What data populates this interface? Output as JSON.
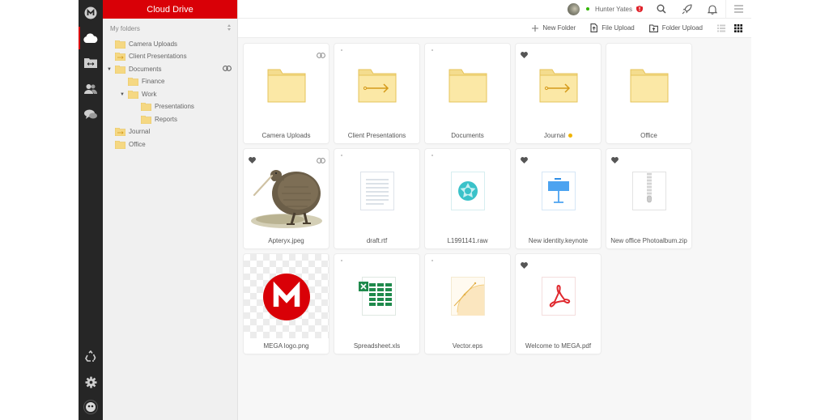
{
  "app": {
    "title": "Cloud Drive",
    "brand_color": "#d90007"
  },
  "rail": {
    "items": [
      {
        "icon": "mega-logo-icon"
      },
      {
        "icon": "cloud-drive-icon",
        "active": true
      },
      {
        "icon": "shared-folder-icon"
      },
      {
        "icon": "contacts-icon"
      },
      {
        "icon": "chat-icon"
      },
      {
        "icon": "rubbish-bin-icon"
      },
      {
        "icon": "settings-icon"
      },
      {
        "icon": "account-avatar-icon"
      }
    ]
  },
  "tree": {
    "header": "My folders",
    "sort_icon": "sort-icon",
    "items": [
      {
        "label": "Camera Uploads",
        "level": 0,
        "icon": "folder-icon"
      },
      {
        "label": "Client Presentations",
        "level": 0,
        "icon": "incoming-folder-icon"
      },
      {
        "label": "Documents",
        "level": 0,
        "expanded": true,
        "icon": "folder-icon",
        "linked": true
      },
      {
        "label": "Finance",
        "level": 1,
        "icon": "folder-icon"
      },
      {
        "label": "Work",
        "level": 1,
        "expanded": true,
        "icon": "folder-icon"
      },
      {
        "label": "Presentations",
        "level": 2,
        "icon": "folder-icon"
      },
      {
        "label": "Reports",
        "level": 2,
        "icon": "folder-icon"
      },
      {
        "label": "Journal",
        "level": 0,
        "icon": "incoming-folder-icon"
      },
      {
        "label": "Office",
        "level": 0,
        "icon": "folder-icon"
      }
    ]
  },
  "topbar": {
    "user_name": "Hunter Yates",
    "online_color": "#31b500",
    "alert_badge": "!",
    "icons": [
      "search-icon",
      "rocket-icon",
      "notification-bell-icon",
      "menu-icon"
    ]
  },
  "toolbar": {
    "new_folder": "New Folder",
    "file_upload": "File Upload",
    "folder_upload": "Folder Upload",
    "view_modes": [
      "list-view",
      "grid-view"
    ],
    "active_view": "grid-view"
  },
  "files": [
    {
      "name": "Camera Uploads",
      "type": "folder",
      "linked": true
    },
    {
      "name": "Client Presentations",
      "type": "incoming-folder"
    },
    {
      "name": "Documents",
      "type": "folder"
    },
    {
      "name": "Journal",
      "type": "incoming-folder",
      "favourite": true,
      "label_color": "#f0b400"
    },
    {
      "name": "Office",
      "type": "folder"
    },
    {
      "name": "Apteryx.jpeg",
      "type": "image",
      "favourite": true,
      "linked": true
    },
    {
      "name": "draft.rtf",
      "type": "text"
    },
    {
      "name": "L1991141.raw",
      "type": "raw"
    },
    {
      "name": "New identity.keynote",
      "type": "keynote",
      "favourite": true
    },
    {
      "name": "New office Photoalbum.zip",
      "type": "zip",
      "favourite": true
    },
    {
      "name": "MEGA logo.png",
      "type": "png"
    },
    {
      "name": "Spreadsheet.xls",
      "type": "spreadsheet"
    },
    {
      "name": "Vector.eps",
      "type": "vector"
    },
    {
      "name": "Welcome to MEGA.pdf",
      "type": "pdf",
      "favourite": true
    }
  ]
}
